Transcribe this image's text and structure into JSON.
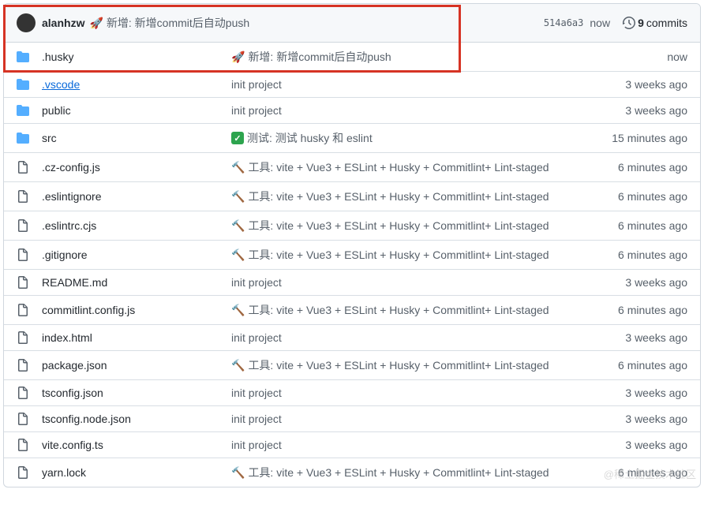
{
  "header": {
    "author": "alanhzw",
    "emoji": "🚀",
    "message": "新增: 新增commit后自动push",
    "sha": "514a6a3",
    "time": "now",
    "commits_count": "9",
    "commits_label": "commits"
  },
  "files": [
    {
      "type": "dir",
      "name": ".husky",
      "msg_emoji": "🚀",
      "msg": "新增: 新增commit后自动push",
      "time": "now",
      "highlight": false
    },
    {
      "type": "dir",
      "name": ".vscode",
      "msg_emoji": "",
      "msg": "init project",
      "time": "3 weeks ago",
      "highlight": true
    },
    {
      "type": "dir",
      "name": "public",
      "msg_emoji": "",
      "msg": "init project",
      "time": "3 weeks ago",
      "highlight": false
    },
    {
      "type": "dir",
      "name": "src",
      "msg_emoji": "✅",
      "msg": "测试: 测试 husky 和 eslint",
      "time": "15 minutes ago",
      "highlight": false,
      "badge": true
    },
    {
      "type": "file",
      "name": ".cz-config.js",
      "msg_emoji": "🔨",
      "msg": "工具: vite + Vue3 + ESLint + Husky + Commitlint+ Lint-staged",
      "time": "6 minutes ago",
      "highlight": false
    },
    {
      "type": "file",
      "name": ".eslintignore",
      "msg_emoji": "🔨",
      "msg": "工具: vite + Vue3 + ESLint + Husky + Commitlint+ Lint-staged",
      "time": "6 minutes ago",
      "highlight": false
    },
    {
      "type": "file",
      "name": ".eslintrc.cjs",
      "msg_emoji": "🔨",
      "msg": "工具: vite + Vue3 + ESLint + Husky + Commitlint+ Lint-staged",
      "time": "6 minutes ago",
      "highlight": false
    },
    {
      "type": "file",
      "name": ".gitignore",
      "msg_emoji": "🔨",
      "msg": "工具: vite + Vue3 + ESLint + Husky + Commitlint+ Lint-staged",
      "time": "6 minutes ago",
      "highlight": false
    },
    {
      "type": "file",
      "name": "README.md",
      "msg_emoji": "",
      "msg": "init project",
      "time": "3 weeks ago",
      "highlight": false
    },
    {
      "type": "file",
      "name": "commitlint.config.js",
      "msg_emoji": "🔨",
      "msg": "工具: vite + Vue3 + ESLint + Husky + Commitlint+ Lint-staged",
      "time": "6 minutes ago",
      "highlight": false
    },
    {
      "type": "file",
      "name": "index.html",
      "msg_emoji": "",
      "msg": "init project",
      "time": "3 weeks ago",
      "highlight": false
    },
    {
      "type": "file",
      "name": "package.json",
      "msg_emoji": "🔨",
      "msg": "工具: vite + Vue3 + ESLint + Husky + Commitlint+ Lint-staged",
      "time": "6 minutes ago",
      "highlight": false
    },
    {
      "type": "file",
      "name": "tsconfig.json",
      "msg_emoji": "",
      "msg": "init project",
      "time": "3 weeks ago",
      "highlight": false
    },
    {
      "type": "file",
      "name": "tsconfig.node.json",
      "msg_emoji": "",
      "msg": "init project",
      "time": "3 weeks ago",
      "highlight": false
    },
    {
      "type": "file",
      "name": "vite.config.ts",
      "msg_emoji": "",
      "msg": "init project",
      "time": "3 weeks ago",
      "highlight": false
    },
    {
      "type": "file",
      "name": "yarn.lock",
      "msg_emoji": "🔨",
      "msg": "工具: vite + Vue3 + ESLint + Husky + Commitlint+ Lint-staged",
      "time": "6 minutes ago",
      "highlight": false
    }
  ],
  "watermark": "@稀土掘金技术社区"
}
